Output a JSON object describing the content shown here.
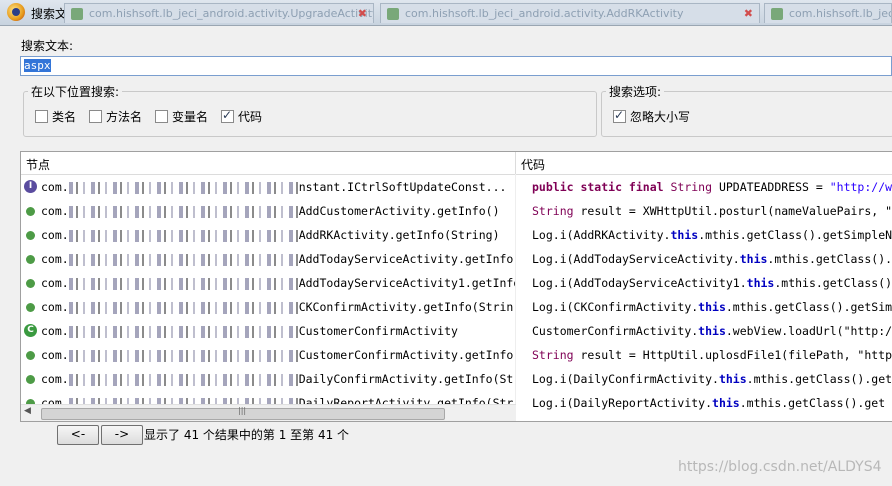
{
  "window": {
    "title": "搜索文本",
    "background_tabs": [
      "com.hishsoft.lb_jeci_android.activity.UpgradeActivity",
      "com.hishsoft.lb_jeci_android.activity.AddRKActivity",
      "com.hishsoft.lb_jeci_android.activity.AddToday"
    ]
  },
  "search": {
    "label": "搜索文本:",
    "value": "aspx"
  },
  "location_group": {
    "title": "在以下位置搜索:",
    "options": [
      {
        "label": "类名",
        "checked": false
      },
      {
        "label": "方法名",
        "checked": false
      },
      {
        "label": "变量名",
        "checked": false
      },
      {
        "label": "代码",
        "checked": true
      }
    ]
  },
  "options_group": {
    "title": "搜索选项:",
    "options": [
      {
        "label": "忽略大小写",
        "checked": true
      }
    ]
  },
  "results": {
    "columns": {
      "node": "节点",
      "code": "代码"
    },
    "rows": [
      {
        "icon": "interface-icon",
        "prefix": "com.",
        "node": "nstant.ICtrlSoftUpdateConst...",
        "code": [
          [
            "kw",
            "public static final "
          ],
          [
            "type",
            "String"
          ],
          [
            "plain",
            " UPDATEADDRESS = "
          ],
          [
            "str",
            "\"http://w"
          ]
        ]
      },
      {
        "icon": "method-icon",
        "prefix": "com.",
        "node": "AddCustomerActivity.getInfo()",
        "code": [
          [
            "type",
            "String"
          ],
          [
            "plain",
            " result = XWHttpUtil.posturl(nameValuePairs, \""
          ]
        ]
      },
      {
        "icon": "method-icon",
        "prefix": "com.",
        "node": "AddRKActivity.getInfo(String)",
        "code": [
          [
            "plain",
            "Log.i(AddRKActivity."
          ],
          [
            "kwb",
            "this"
          ],
          [
            "plain",
            ".mthis.getClass().getSimpleN"
          ]
        ]
      },
      {
        "icon": "method-icon",
        "prefix": "com.",
        "node": "AddTodayServiceActivity.getInfo",
        "code": [
          [
            "plain",
            "Log.i(AddTodayServiceActivity."
          ],
          [
            "kwb",
            "this"
          ],
          [
            "plain",
            ".mthis.getClass()."
          ]
        ]
      },
      {
        "icon": "method-icon",
        "prefix": "com.",
        "node": "AddTodayServiceActivity1.getInfo",
        "code": [
          [
            "plain",
            "Log.i(AddTodayServiceActivity1."
          ],
          [
            "kwb",
            "this"
          ],
          [
            "plain",
            ".mthis.getClass()"
          ]
        ]
      },
      {
        "icon": "method-icon",
        "prefix": "com.",
        "node": "CKConfirmActivity.getInfo(Strin",
        "code": [
          [
            "plain",
            "Log.i(CKConfirmActivity."
          ],
          [
            "kwb",
            "this"
          ],
          [
            "plain",
            ".mthis.getClass().getSim"
          ]
        ]
      },
      {
        "icon": "class-icon",
        "prefix": "com.",
        "node": "CustomerConfirmActivity",
        "code": [
          [
            "plain",
            "CustomerConfirmActivity."
          ],
          [
            "kwb",
            "this"
          ],
          [
            "plain",
            ".webView.loadUrl(\"http:/"
          ]
        ]
      },
      {
        "icon": "method-icon",
        "prefix": "com.",
        "node": "CustomerConfirmActivity.getInfo",
        "code": [
          [
            "type",
            "String"
          ],
          [
            "plain",
            " result = HttpUtil.uplosdFile1(filePath, \"http"
          ]
        ]
      },
      {
        "icon": "method-icon",
        "prefix": "com.",
        "node": "DailyConfirmActivity.getInfo(St",
        "code": [
          [
            "plain",
            "Log.i(DailyConfirmActivity."
          ],
          [
            "kwb",
            "this"
          ],
          [
            "plain",
            ".mthis.getClass().get"
          ]
        ]
      },
      {
        "icon": "method-icon",
        "prefix": "com.",
        "node": "DailyReportActivity.getInfo(Str",
        "code": [
          [
            "plain",
            "Log.i(DailyReportActivity."
          ],
          [
            "kwb",
            "this"
          ],
          [
            "plain",
            ".mthis.getClass().get"
          ]
        ]
      }
    ]
  },
  "pager": {
    "prev_label": "<-",
    "next_label": "->",
    "status": "显示了 41 个结果中的第 1 至第 41 个"
  },
  "watermark": "https://blog.csdn.net/ALDYS4",
  "colors": {
    "keyword": "#7f0055",
    "this_keyword": "#0000c0",
    "string": "#2a00ff",
    "selection": "#3375d8",
    "method_icon": "#4d9b46",
    "interface_icon": "#5a4c9f"
  }
}
